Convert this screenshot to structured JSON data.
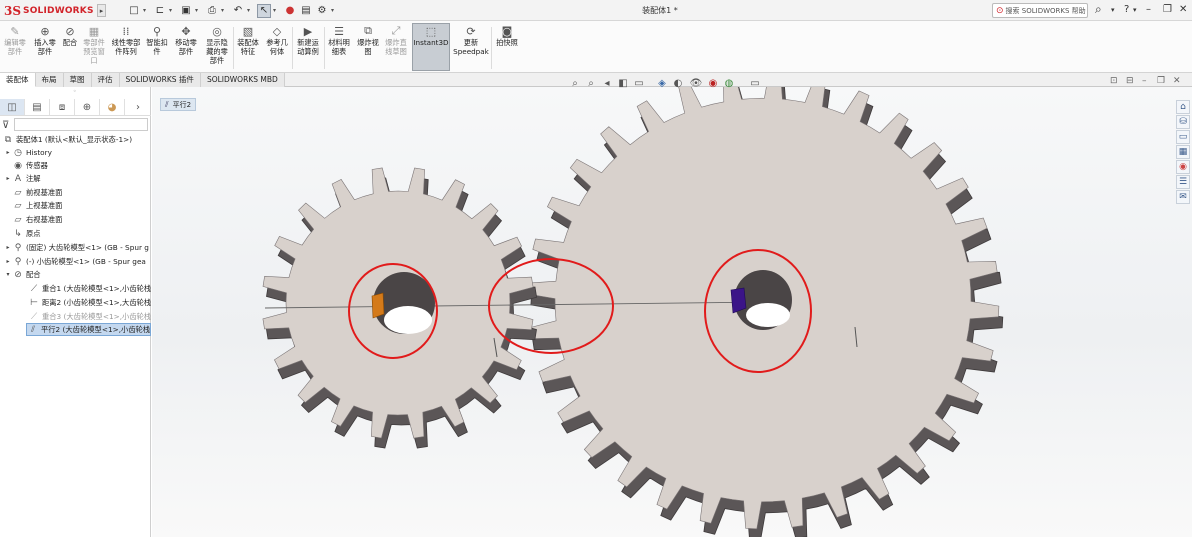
{
  "app": {
    "logo_ds": "3S",
    "logo_text": "SOLIDWORKS",
    "document_title": "装配体1 *",
    "search_placeholder": "搜索 SOLIDWORKS 帮助",
    "help_label": "?"
  },
  "ribbon": {
    "buttons": [
      {
        "label": "编辑零\n部件",
        "icon": "edit-component-icon",
        "disabled": true
      },
      {
        "label": "插入零\n部件",
        "icon": "insert-component-icon",
        "disabled": false
      },
      {
        "label": "配合",
        "icon": "mate-icon",
        "disabled": false
      },
      {
        "label": "零部件\n预览窗\n口",
        "icon": "component-preview-icon",
        "disabled": true
      },
      {
        "label": "线性零部\n件阵列",
        "icon": "linear-pattern-icon",
        "disabled": false
      },
      {
        "label": "智能扣\n件",
        "icon": "smart-fasteners-icon",
        "disabled": false
      },
      {
        "label": "移动零\n部件",
        "icon": "move-component-icon",
        "disabled": false
      },
      {
        "label": "显示隐\n藏的零\n部件",
        "icon": "show-hidden-icon",
        "disabled": false
      },
      {
        "label": "装配体\n特征",
        "icon": "assembly-feature-icon",
        "disabled": false
      },
      {
        "label": "参考几\n何体",
        "icon": "reference-geometry-icon",
        "disabled": false
      },
      {
        "label": "新建运\n动算例",
        "icon": "motion-study-icon",
        "disabled": false
      },
      {
        "label": "材料明\n细表",
        "icon": "bom-icon",
        "disabled": false
      },
      {
        "label": "爆炸视\n图",
        "icon": "exploded-view-icon",
        "disabled": false
      },
      {
        "label": "爆炸直\n线草图",
        "icon": "explode-line-sketch-icon",
        "disabled": true
      },
      {
        "label": "Instant3D",
        "icon": "instant3d-icon",
        "disabled": false
      },
      {
        "label": "更新\nSpeedpak",
        "icon": "speedpak-icon",
        "disabled": false
      },
      {
        "label": "拍快照",
        "icon": "snapshot-icon",
        "disabled": false
      }
    ]
  },
  "tabs": [
    "装配体",
    "布局",
    "草图",
    "评估",
    "SOLIDWORKS 插件",
    "SOLIDWORKS MBD"
  ],
  "active_tab": "装配体",
  "tree": {
    "root": "装配体1 (默认<默认_显示状态-1>)",
    "items": [
      {
        "label": "History",
        "icon": "history-icon",
        "expand": "▸",
        "level": 1
      },
      {
        "label": "传感器",
        "icon": "sensor-icon",
        "expand": "",
        "level": 1
      },
      {
        "label": "注解",
        "icon": "annotation-icon",
        "expand": "▸",
        "level": 1
      },
      {
        "label": "前视基准面",
        "icon": "plane-icon",
        "expand": "",
        "level": 1
      },
      {
        "label": "上视基准面",
        "icon": "plane-icon",
        "expand": "",
        "level": 1
      },
      {
        "label": "右视基准面",
        "icon": "plane-icon",
        "expand": "",
        "level": 1
      },
      {
        "label": "原点",
        "icon": "origin-icon",
        "expand": "",
        "level": 1
      },
      {
        "label": "(固定) 大齿轮模型<1> (GB - Spur g",
        "icon": "part-icon",
        "expand": "▸",
        "level": 1
      },
      {
        "label": "(-) 小齿轮模型<1> (GB - Spur gea",
        "icon": "part-icon",
        "expand": "▸",
        "level": 1
      },
      {
        "label": "配合",
        "icon": "mates-folder-icon",
        "expand": "▾",
        "level": 1
      },
      {
        "label": "重合1 (大齿轮模型<1>,小齿轮栈",
        "icon": "coincident-icon",
        "expand": "",
        "level": 2
      },
      {
        "label": "距离2 (小齿轮模型<1>,大齿轮栈",
        "icon": "distance-icon",
        "expand": "",
        "level": 2
      },
      {
        "label": "重合3 (大齿轮模型<1>,小齿轮栈",
        "icon": "coincident-icon",
        "expand": "",
        "level": 2,
        "grey": true
      },
      {
        "label": "平行2 (大齿轮模型<1>,小齿轮栈",
        "icon": "parallel-icon",
        "expand": "",
        "level": 2,
        "selected": true
      }
    ]
  },
  "viewport": {
    "breadcrumb": "平行2"
  }
}
